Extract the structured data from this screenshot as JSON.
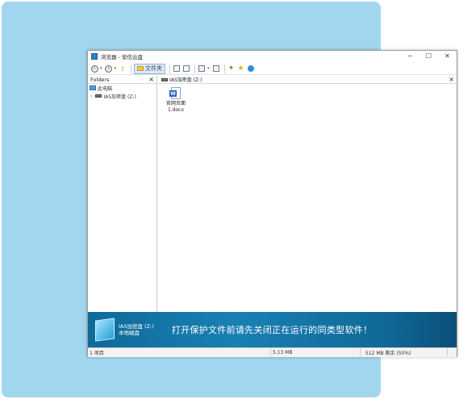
{
  "window": {
    "title": "浏览器 - 安信云盘",
    "controls": {
      "minimize": "─",
      "maximize": "☐",
      "close": "✕"
    }
  },
  "toolbar": {
    "back_icon": "back-arrow-icon",
    "forward_icon": "forward-arrow-icon",
    "up_icon": "up-folder-icon",
    "folders_label": "文件夹",
    "caret": "▾"
  },
  "left_pane": {
    "header": "Folders",
    "close": "×",
    "tree": [
      {
        "label": "此电脑",
        "icon": "computer-icon"
      },
      {
        "label": "IAS加密盘 (Z:)",
        "icon": "drive-icon",
        "expander": "›"
      }
    ]
  },
  "right_pane": {
    "tab_label": "IAS加密盘 (Z:)",
    "tab_close": "×",
    "files": [
      {
        "name_line1": "官网页面",
        "name_line2": "1.docx",
        "icon": "word-document-icon"
      }
    ]
  },
  "banner": {
    "drive_name": "IAS加密盘 (Z:)",
    "drive_type": "本地磁盘",
    "message": "打开保护文件前请先关闭正在运行的同类型软件！"
  },
  "status": {
    "items": "1 项目",
    "size": "5.13 MB",
    "free": "512 MB 剩余 (50%)"
  },
  "colors": {
    "background_panel": "#a2d6ef",
    "banner": "#1980b3"
  }
}
